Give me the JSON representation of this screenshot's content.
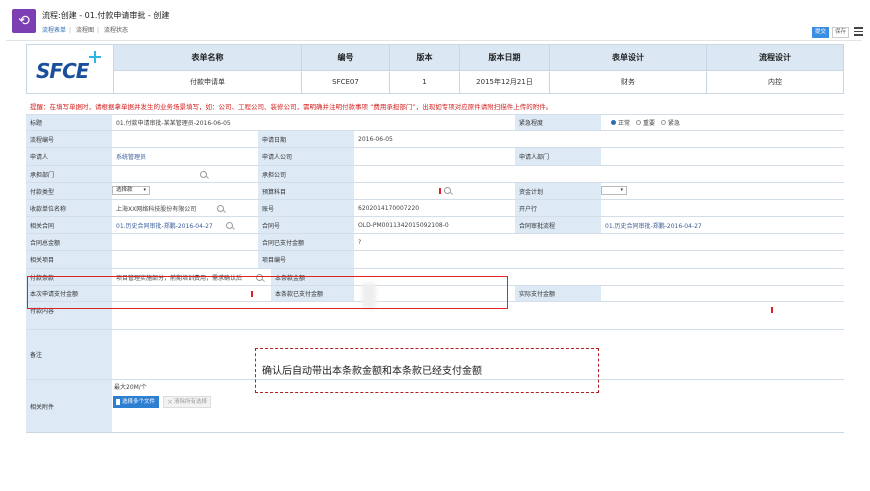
{
  "window": {
    "title": "流程:创建 - 01.付款申请审批 - 创建",
    "tabs": [
      "流程表单",
      "流程图",
      "流程状态"
    ]
  },
  "toolbar": {
    "submit_label": "提交",
    "save_label": "保存",
    "menu_icon": "hamburger-menu-icon"
  },
  "header": {
    "logo_text": "SFCE",
    "columns": [
      "表单名称",
      "编号",
      "版本",
      "版本日期",
      "表单设计",
      "流程设计"
    ],
    "values": [
      "付款申请单",
      "SFCE07",
      "1",
      "2015年12月21日",
      "财务",
      "内控"
    ]
  },
  "notice": "提醒：在填写单据时，请根据拿单据并发生的业务场景填写，如：公司、工程公司、装修公司，需明确并注明付款事项 “费用承担部门”，出现如专项对应原件请附扫描件上传的附件。",
  "form": {
    "title_label": "标题",
    "title_value": "01.付款申请审批-某某管理员-2016-06-05",
    "urgency_label": "紧急程度",
    "urgency_options": [
      "正常",
      "重要",
      "紧急"
    ],
    "process_no_label": "流程编号",
    "apply_date_label": "申请日期",
    "apply_date_value": "2016-06-05",
    "applicant_label": "申请人",
    "applicant_value": "系统管理员",
    "applicant_company_label": "申请人公司",
    "applicant_dept_label": "申请人部门",
    "cost_dept_label": "承担部门",
    "cost_company_label": "承担公司",
    "pay_type_label": "付款类型",
    "pay_type_value": "选择款",
    "budget_subject_label": "预算科目",
    "fund_plan_label": "资金计划",
    "payee_label": "收款单位名称",
    "payee_value": "上海XX网络科技股份有限公司",
    "account_label": "账号",
    "account_value": "6202014170007220",
    "bank_label": "开户行",
    "contract_label": "相关合同",
    "contract_value": "01.历史合同审批-郑鹏-2016-04-27",
    "contract_no_label": "合同号",
    "contract_no_value": "OLD-PM0011342015092108-0",
    "contract_flow_label": "合同审批流程",
    "contract_flow_value": "01.历史合同审批-郑鹏-2016-04-27",
    "contract_total_label": "合同总金额",
    "contract_paid_label": "合同已支付金额",
    "contract_paid_value": "?",
    "project_label": "相关项目",
    "project_no_label": "项目编号",
    "pay_terms_label": "付款条款",
    "pay_terms_value": "项目管理实施部分，前期培训费用，需求确认后",
    "terms_amount_label": "本条款金额",
    "this_pay_label": "本次申请支付金额",
    "terms_paid_label": "本条款已支付金额",
    "actual_pay_label": "实际支付金额",
    "pay_content_label": "付款内容",
    "remark_label": "备注",
    "attach_label": "相关附件",
    "attach_size": "最大20M/个",
    "upload_label": "选择多个文件",
    "clear_label": "清除所有选择"
  },
  "annotation": "确认后自动带出本条款金额和本条款已经支付金额"
}
